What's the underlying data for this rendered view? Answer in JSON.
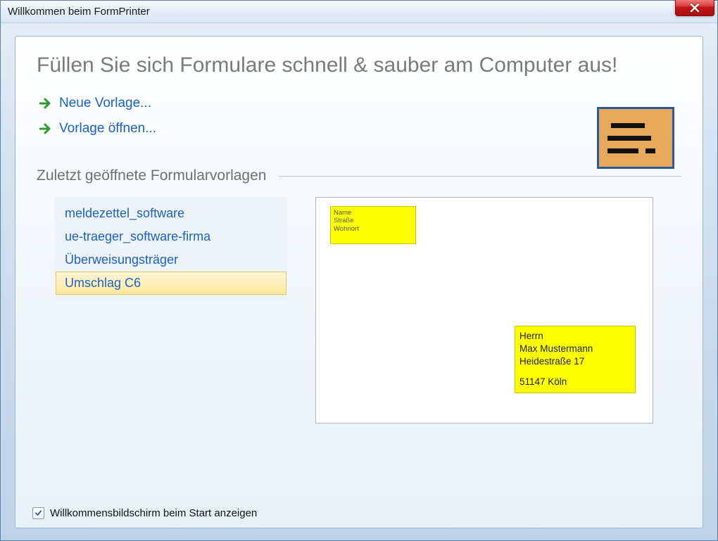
{
  "window": {
    "title": "Willkommen beim FormPrinter"
  },
  "headline": "Füllen Sie sich Formulare schnell & sauber am Computer aus!",
  "actions": {
    "new_template": "Neue Vorlage...",
    "open_template": "Vorlage öffnen..."
  },
  "recent": {
    "heading": "Zuletzt geöffnete Formularvorlagen",
    "items": [
      {
        "label": "meldezettel_software",
        "selected": false
      },
      {
        "label": "ue-traeger_software-firma",
        "selected": false
      },
      {
        "label": "Überweisungsträger",
        "selected": false
      },
      {
        "label": "Umschlag C6",
        "selected": true
      }
    ]
  },
  "preview": {
    "sender": {
      "line1": "Name",
      "line2": "Straße",
      "line3": "Wohnort"
    },
    "recipient": {
      "line1": "Herrn",
      "line2": "Max Mustermann",
      "line3": "Heidestraße 17",
      "line4": "51147 Köln"
    }
  },
  "footer": {
    "show_welcome_label": "Willkommensbildschirm beim Start anzeigen",
    "show_welcome_checked": true
  }
}
